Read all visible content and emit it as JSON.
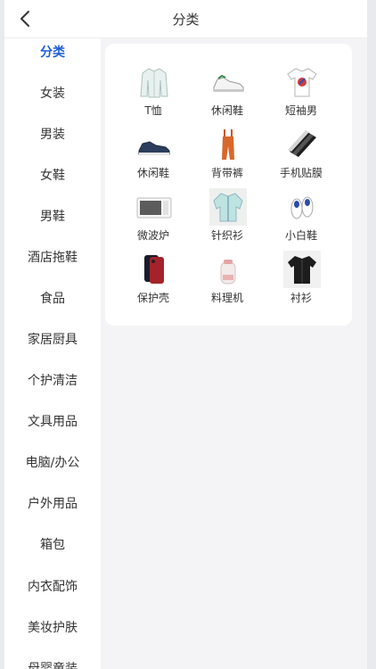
{
  "header": {
    "title": "分类",
    "back_icon": "chevron-left-icon"
  },
  "sidebar": {
    "active_color": "#1e5fd6",
    "items": [
      {
        "label": "分类",
        "active": true
      },
      {
        "label": "女装"
      },
      {
        "label": "男装"
      },
      {
        "label": "女鞋"
      },
      {
        "label": "男鞋"
      },
      {
        "label": "酒店拖鞋"
      },
      {
        "label": "食品"
      },
      {
        "label": "家居厨具"
      },
      {
        "label": "个护清洁"
      },
      {
        "label": "文具用品"
      },
      {
        "label": "电脑/办公"
      },
      {
        "label": "户外用品"
      },
      {
        "label": "箱包"
      },
      {
        "label": "内衣配饰"
      },
      {
        "label": "美妆护肤"
      },
      {
        "label": "母婴童装"
      }
    ]
  },
  "products": [
    {
      "label": "T恤",
      "icon": "long-shirt-icon"
    },
    {
      "label": "休闲鞋",
      "icon": "white-sneaker-icon"
    },
    {
      "label": "短袖男",
      "icon": "graphic-tshirt-icon"
    },
    {
      "label": "休闲鞋",
      "icon": "navy-sneaker-icon"
    },
    {
      "label": "背带裤",
      "icon": "overalls-icon"
    },
    {
      "label": "手机贴膜",
      "icon": "screen-protector-icon"
    },
    {
      "label": "微波炉",
      "icon": "microwave-icon"
    },
    {
      "label": "针织衫",
      "icon": "cardigan-icon"
    },
    {
      "label": "小白鞋",
      "icon": "white-shoes-icon"
    },
    {
      "label": "保护壳",
      "icon": "phone-case-icon"
    },
    {
      "label": "料理机",
      "icon": "blender-icon"
    },
    {
      "label": "衬衫",
      "icon": "black-shirt-icon"
    }
  ]
}
